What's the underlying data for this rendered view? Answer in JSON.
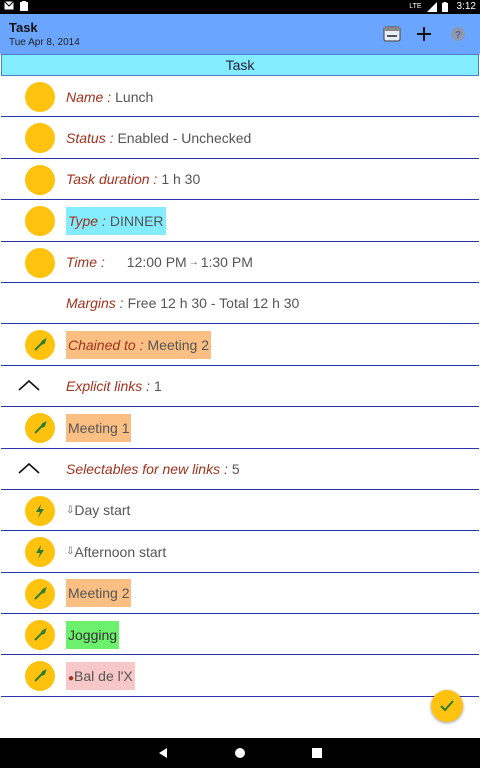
{
  "status_bar": {
    "time": "3:12",
    "network": "LTE"
  },
  "app_bar": {
    "title": "Task",
    "subtitle": "Tue Apr 8, 2014"
  },
  "section": {
    "title": "Task"
  },
  "rows": {
    "name": {
      "label": "Name :",
      "value": "Lunch"
    },
    "status": {
      "label": "Status :",
      "value": "Enabled - Unchecked"
    },
    "duration": {
      "label": "Task duration :",
      "value": "1 h 30"
    },
    "type": {
      "label": "Type :",
      "value": "DINNER"
    },
    "time": {
      "label": "Time :",
      "start": "12:00 PM",
      "arrow": "→",
      "end": "1:30 PM"
    },
    "margins": {
      "label": "Margins :",
      "value": "Free 12 h 30 - Total 12 h 30"
    },
    "chained": {
      "label": "Chained to :",
      "value": "Meeting 2"
    },
    "explicit_links": {
      "label": "Explicit links :",
      "value": "1"
    },
    "meeting1": {
      "value": "Meeting 1"
    },
    "selectables": {
      "label": "Selectables for new links :",
      "value": "5"
    },
    "day_start": {
      "value": "Day start"
    },
    "afternoon_start": {
      "value": "Afternoon start"
    },
    "meeting2": {
      "value": "Meeting 2"
    },
    "jogging": {
      "value": "Jogging"
    },
    "bal": {
      "value": "Bal de l'X"
    }
  },
  "colors": {
    "app_bar": "#6aa5ff",
    "section_header": "#84ecff",
    "circle": "#ffc20f",
    "label": "#a0321e",
    "divider": "#2d35a8"
  }
}
